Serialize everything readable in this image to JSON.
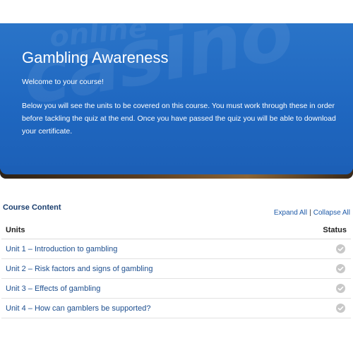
{
  "banner": {
    "title": "Gambling Awareness",
    "welcome": "Welcome to your course!",
    "intro": "Below you will see the units to be covered on this course. You must work through these in order before tackling the quiz at the end. Once you have passed the quiz you will be able to download your certificate.",
    "watermark_top": "online",
    "watermark_main": "casino"
  },
  "course": {
    "heading": "Course Content",
    "expand_all": "Expand All",
    "separator": "|",
    "collapse_all": "Collapse All"
  },
  "table": {
    "col_units": "Units",
    "col_status": "Status",
    "rows": [
      {
        "label": "Unit 1 – Introduction to gambling",
        "status_icon": "check-circle-icon"
      },
      {
        "label": "Unit 2 – Risk factors and signs of gambling",
        "status_icon": "check-circle-icon"
      },
      {
        "label": "Unit 3 – Effects of gambling",
        "status_icon": "check-circle-icon"
      },
      {
        "label": "Unit 4 – How can gamblers be supported?",
        "status_icon": "check-circle-icon"
      }
    ]
  },
  "colors": {
    "banner_blue": "#1f67c0",
    "link_blue": "#1e4f8f",
    "status_gray": "#c8c8c8"
  }
}
